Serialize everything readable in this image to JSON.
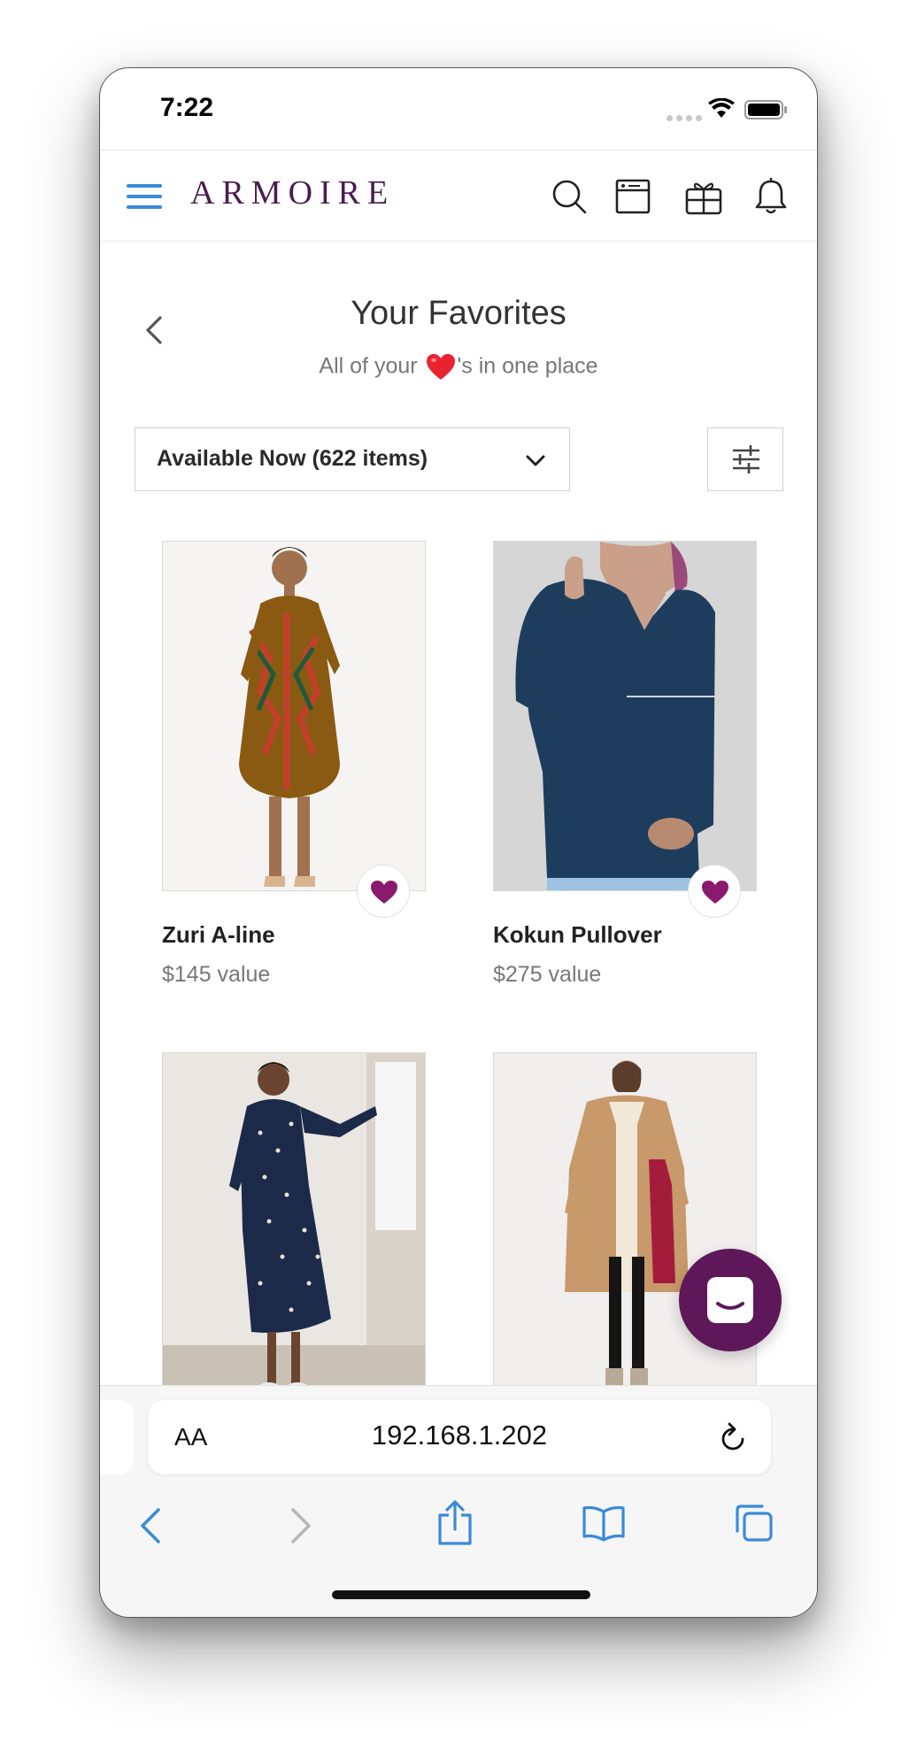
{
  "status_bar": {
    "time": "7:22"
  },
  "header": {
    "logo": "ARMOIRE"
  },
  "page": {
    "title": "Your Favorites",
    "subtitle_before": "All of your ",
    "subtitle_after": "'s in one place"
  },
  "filter": {
    "dropdown_value": "Available Now (622 items)"
  },
  "products": [
    {
      "name": "Zuri A-line",
      "price": "$145 value",
      "favorited": true
    },
    {
      "name": "Kokun Pullover",
      "price": "$275 value",
      "favorited": true
    },
    {
      "name": "",
      "price": "",
      "favorited": true
    },
    {
      "name": "",
      "price": "",
      "favorited": true
    }
  ],
  "browser": {
    "text_size_label": "AA",
    "url": "192.168.1.202"
  },
  "colors": {
    "brand": "#4a1d4f",
    "accent_blue": "#3b8ad9",
    "heart": "#8a1a6e",
    "chat_bubble": "#5e1759"
  }
}
